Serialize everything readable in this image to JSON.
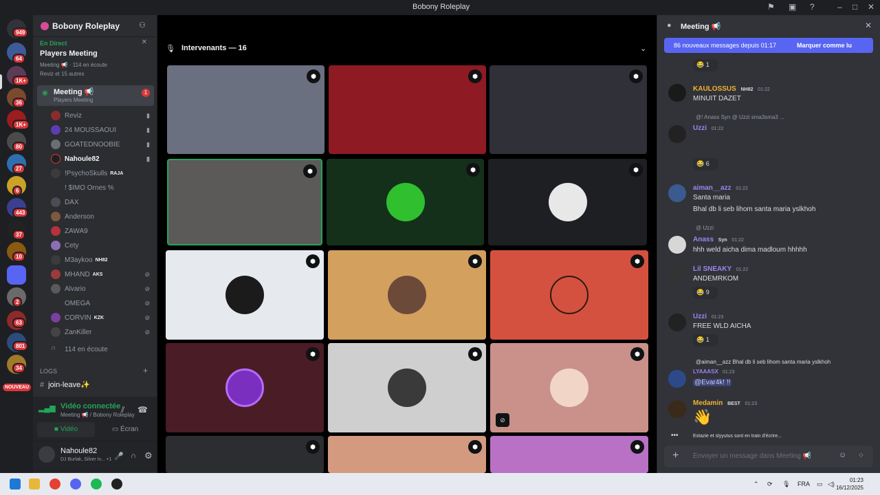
{
  "window": {
    "title": "Bobony Roleplay"
  },
  "servers": {
    "badges": [
      "949",
      "64",
      "1K+",
      "36",
      "1K+",
      "80",
      "27",
      "6",
      "443",
      "37",
      "10",
      "2",
      "63",
      "801",
      "34"
    ],
    "new_label": "NOUVEAU"
  },
  "sidebar": {
    "server_name": "Bobony Roleplay",
    "event_live": "En Direct",
    "event_title": "Players Meeting",
    "event_info": "Meeting 📢 · 114 en écoute",
    "event_others": "Reviz et 15 autres",
    "meeting_name": "Meeting 📢",
    "meeting_sub": "Players Meeting",
    "meeting_badge": "1",
    "members": [
      {
        "name": "Reviz",
        "tag": ""
      },
      {
        "name": "24 MOUSSAOUI",
        "tag": ""
      },
      {
        "name": "GOATEDNOOBIE",
        "tag": ""
      },
      {
        "name": "Nahoule82",
        "tag": ""
      },
      {
        "name": "!PsychoSkulls",
        "tag": "RAJA"
      },
      {
        "name": "! $IMO Ornes %",
        "tag": ""
      },
      {
        "name": "DAX",
        "tag": ""
      },
      {
        "name": "Anderson",
        "tag": ""
      },
      {
        "name": "ZAWA9",
        "tag": ""
      },
      {
        "name": "Cety",
        "tag": ""
      },
      {
        "name": "M3aykoo",
        "tag": "NH82"
      },
      {
        "name": "MHAND",
        "tag": "AKS"
      },
      {
        "name": "Alvario",
        "tag": ""
      },
      {
        "name": "OMEGA",
        "tag": ""
      },
      {
        "name": "CORVIN",
        "tag": "KZK"
      },
      {
        "name": "ZanKiller",
        "tag": ""
      }
    ],
    "listeners": "114 en écoute",
    "category": "LOGS",
    "channel": "join-leave✨"
  },
  "voice": {
    "status": "Vidéo connectée",
    "location": "Meeting 📢 / Bobony Roleplay",
    "video_label": "Vidéo",
    "screen_label": "Écran"
  },
  "user": {
    "name": "Nahoule82",
    "activity": "DJ Burlak, Silver Iv... +1"
  },
  "stage": {
    "header": "Intervenants — 16"
  },
  "chat": {
    "channel": "Meeting 📢",
    "new_messages": "86 nouveaux messages depuis 01:17",
    "mark_read": "Marquer comme lu",
    "messages": [
      {
        "user": "KAULOSSUS",
        "badge": "NH82",
        "time": "01:22",
        "text": "MINUIT DAZET"
      },
      {
        "reply": "@!   Anass  Syn  @ Uzzi  sma3sma3 ...",
        "user": "Uzzi",
        "time": "01:22",
        "react": "6"
      },
      {
        "user": "aiman__azz",
        "time": "01:22",
        "text": "Santa maria",
        "text2": "Bhal db li seb lihom santa maria yslkhoh"
      },
      {
        "reply": "@ Uzzi",
        "user": "Anass",
        "badge": "Syn",
        "time": "01:22",
        "text": "hhh weld aicha dima madloum hhhhh"
      },
      {
        "user": "Lil SNEAKY",
        "time": "01:22",
        "text": "ANDEMRKOM",
        "react": "9"
      },
      {
        "user": "Uzzi",
        "time": "01:23",
        "text": "FREE WLD AICHA",
        "react": "1"
      },
      {
        "reply": "@aiman__azz Bhal db li seb lihom santa maria yslkhoh",
        "user": "LYAAASX",
        "time": "01:23",
        "text": "@Evar4k! !!"
      },
      {
        "user": "Medamin",
        "badge": "BEST",
        "time": "01:23",
        "text": "👋"
      }
    ],
    "top_react": "1",
    "typing": "Extazie et slyyutus sont en train d'écrire...",
    "placeholder": "Envoyer un message dans Meeting 📢"
  },
  "taskbar": {
    "lang": "FRA",
    "time": "01:23",
    "date": "16/12/2025"
  },
  "colors": {
    "accent": "#5865f2",
    "live": "#23a559",
    "bg": "#1e1f22"
  }
}
